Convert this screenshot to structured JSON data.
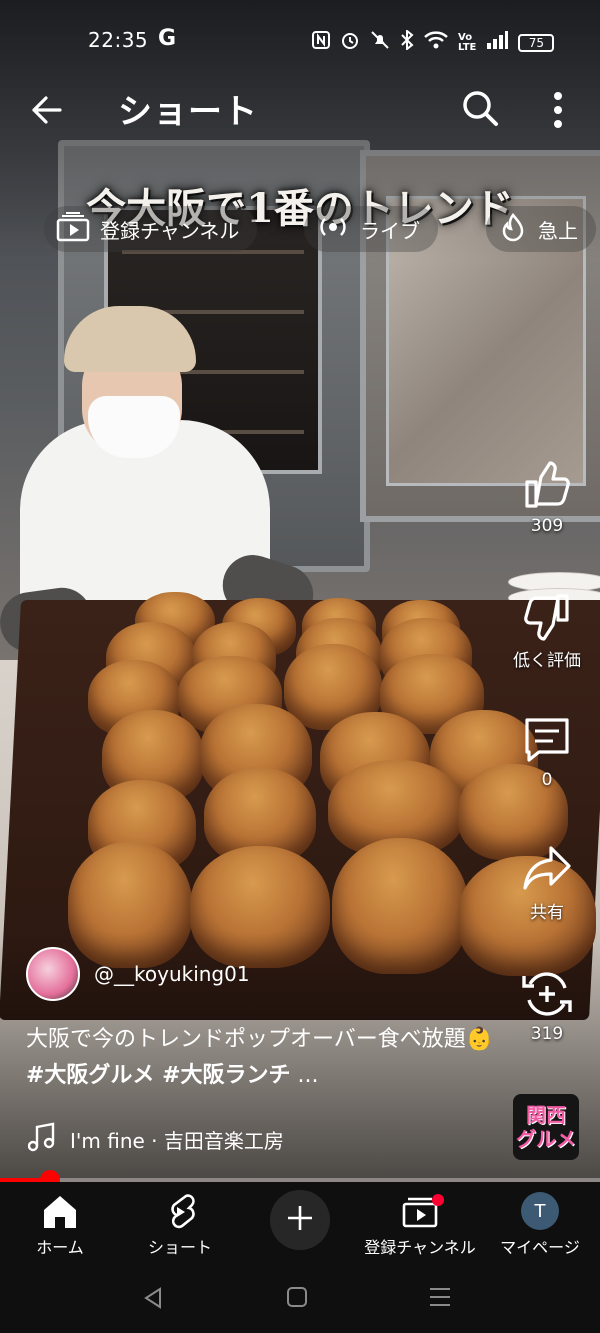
{
  "status_bar": {
    "time": "22:35",
    "google_indicator": "G",
    "battery": "75",
    "icons": [
      "nfc-icon",
      "alarm-icon",
      "mute-icon",
      "bluetooth-icon",
      "wifi-icon",
      "volte-icon",
      "signal-icon"
    ]
  },
  "header": {
    "title": "ショート",
    "icons": [
      "back-arrow-icon",
      "search-icon",
      "more-vert-icon"
    ]
  },
  "chips": [
    {
      "label": "登録チャンネル",
      "icon": "subscriptions-icon"
    },
    {
      "label": "ライブ",
      "icon": "live-icon"
    },
    {
      "label": "急上",
      "icon": "trending-icon"
    }
  ],
  "video": {
    "caption": "今大阪で1番のトレンド"
  },
  "actions": {
    "like": {
      "label": "309",
      "icon": "thumb-up-icon"
    },
    "dislike": {
      "label": "低く評価",
      "icon": "thumb-down-icon"
    },
    "comments": {
      "label": "0",
      "icon": "comment-icon"
    },
    "share": {
      "label": "共有",
      "icon": "share-icon"
    },
    "remix": {
      "label": "319",
      "icon": "remix-icon"
    }
  },
  "channel": {
    "handle": "@__koyuking01"
  },
  "description": {
    "text": "大阪で今のトレンドポップオーバー食べ放題",
    "emoji": "👶",
    "hashtags": "#大阪グルメ #大阪ランチ",
    "ellipsis": "..."
  },
  "music": {
    "title": "I'm fine · 吉田音楽工房",
    "icon": "music-note-icon"
  },
  "sound_badge": {
    "line1": "関西",
    "line2": "グルメ"
  },
  "progress": {
    "fraction": 0.083
  },
  "bottom_nav": {
    "items": [
      {
        "label": "ホーム",
        "icon": "home-icon"
      },
      {
        "label": "ショート",
        "icon": "shorts-icon"
      },
      {
        "label": "",
        "icon": "create-plus-icon"
      },
      {
        "label": "登録チャンネル",
        "icon": "subscriptions-icon"
      },
      {
        "label": "マイページ",
        "icon": "account-avatar"
      }
    ],
    "account_initial": "T"
  },
  "system_nav": [
    "back-triangle-icon",
    "home-square-icon",
    "recents-icon"
  ],
  "colors": {
    "accent": "#ff0000",
    "nav_bg": "#0f0f0f",
    "badge_text": "#f25aa4"
  }
}
